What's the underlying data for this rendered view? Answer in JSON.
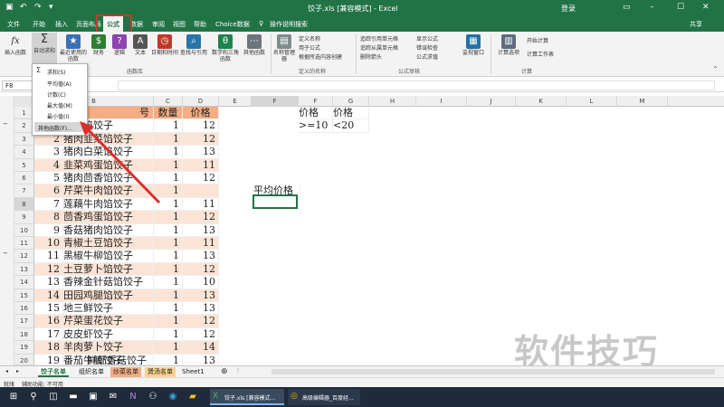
{
  "title_bar": {
    "doc_title": "饺子.xls [兼容模式] - Excel",
    "login": "登录"
  },
  "tabs": [
    "文件",
    "开始",
    "插入",
    "页面布局",
    "公式",
    "数据",
    "审阅",
    "视图",
    "帮助",
    "Choice数据",
    "操作说明搜索",
    "共享"
  ],
  "ribbon": {
    "insert_function": "插入函数",
    "autosum": "自动求和",
    "recent": "最近使用的函数",
    "financial": "财务",
    "logical": "逻辑",
    "text": "文本",
    "datetime": "日期和时间",
    "lookup": "查找与引用",
    "math": "数学和三角函数",
    "more": "其他函数",
    "library_group": "函数库",
    "name_manager": "名称管理器",
    "define_name": "定义名称",
    "use_in_formula": "用于公式",
    "create_from_sel": "根据所选内容创建",
    "names_group": "定义的名称",
    "trace_prec": "追踪引用单元格",
    "trace_dep": "追踪从属单元格",
    "remove_arrows": "删除箭头",
    "show_formulas": "显示公式",
    "error_check": "错误检查",
    "eval_formula": "公式求值",
    "audit_group": "公式审核",
    "watch": "监视窗口",
    "calc_options": "计算选项",
    "calc_now": "开始计算",
    "calc_sheet": "计算工作表",
    "calc_group": "计算"
  },
  "name_box": "F8",
  "dropdown": {
    "items": [
      "求和(S)",
      "平均值(A)",
      "计数(C)",
      "最大值(M)",
      "最小值(I)",
      "其他函数(F)..."
    ]
  },
  "columns": [
    "B",
    "C",
    "D",
    "E",
    "F",
    "G",
    "H",
    "I",
    "J",
    "K",
    "L",
    "M",
    "N"
  ],
  "rows": [
    "1",
    "2",
    "3",
    "4",
    "5",
    "6",
    "7",
    "8",
    "9",
    "10",
    "11",
    "12",
    "13",
    "14",
    "15",
    "16",
    "17",
    "18",
    "19",
    "20"
  ],
  "table": {
    "header_qty": "数量",
    "header_price": "价格",
    "header_partial": "号",
    "items": [
      {
        "no": "",
        "name": "虾仁馅饺子",
        "qty": "1",
        "price": "12"
      },
      {
        "no": "2",
        "name": "猪肉韭菜馅饺子",
        "qty": "1",
        "price": "12"
      },
      {
        "no": "3",
        "name": "猪肉白菜馅饺子",
        "qty": "1",
        "price": "13"
      },
      {
        "no": "4",
        "name": "韭菜鸡蛋馅饺子",
        "qty": "1",
        "price": "11"
      },
      {
        "no": "5",
        "name": "猪肉茴香馅饺子",
        "qty": "1",
        "price": "12"
      },
      {
        "no": "6",
        "name": "芹菜牛肉馅饺子",
        "qty": "1",
        "price": ""
      },
      {
        "no": "7",
        "name": "莲藕牛肉馅饺子",
        "qty": "1",
        "price": "11"
      },
      {
        "no": "8",
        "name": "茴香鸡蛋馅饺子",
        "qty": "1",
        "price": "12"
      },
      {
        "no": "9",
        "name": "香菇猪肉馅饺子",
        "qty": "1",
        "price": "13"
      },
      {
        "no": "10",
        "name": "青椒土豆馅饺子",
        "qty": "1",
        "price": "11"
      },
      {
        "no": "11",
        "name": "黑椒牛柳馅饺子",
        "qty": "1",
        "price": "13"
      },
      {
        "no": "12",
        "name": "土豆萝卜馅饺子",
        "qty": "1",
        "price": "12"
      },
      {
        "no": "13",
        "name": "香辣金针菇馅饺子",
        "qty": "1",
        "price": "10"
      },
      {
        "no": "14",
        "name": "田园鸡腿馅饺子",
        "qty": "1",
        "price": "13"
      },
      {
        "no": "15",
        "name": "地三鲜饺子",
        "qty": "1",
        "price": "13"
      },
      {
        "no": "16",
        "name": "芹菜蛋花饺子",
        "qty": "1",
        "price": "12"
      },
      {
        "no": "17",
        "name": "皮皮虾饺子",
        "qty": "1",
        "price": "12"
      },
      {
        "no": "18",
        "name": "羊肉萝卜饺子",
        "qty": "1",
        "price": "14"
      },
      {
        "no": "19",
        "name": "番茄牛腩饺子",
        "qty": "1",
        "price": "13"
      }
    ],
    "partial_row_name": "鲜虾香菇饺子"
  },
  "criteria": {
    "g_head": "价格",
    "h_head": "价格",
    "g_val": ">=10",
    "h_val": "<20",
    "f_label": "平均价格"
  },
  "sheet_tabs": [
    "饺子名单",
    "组织名单",
    "炒菜名单",
    "煲汤名单",
    "Sheet1"
  ],
  "status": {
    "ready": "就绪",
    "accessibility": "辅助功能: 不可用"
  },
  "taskbar": {
    "excel_label": "饺子.xls [兼容模式...",
    "chrome_label": "高级编辑器_百度经..."
  },
  "watermark": "软件技巧",
  "colors": {
    "excel_green": "#217346",
    "orange_header": "#f4ad84",
    "peach_row": "#fbe4d6",
    "highlight_red": "#d9302c"
  }
}
